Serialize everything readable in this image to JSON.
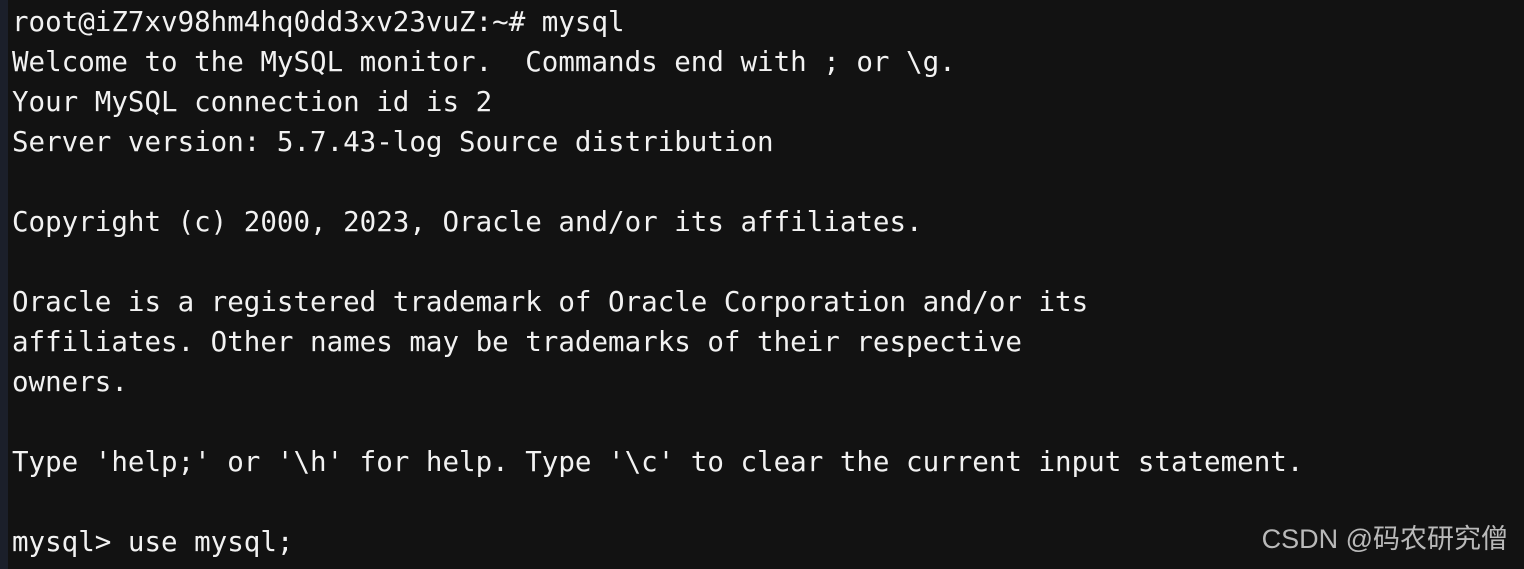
{
  "window": {
    "title": "root@iZ7xv98hm4hq0dd3xv23vuZ: ~",
    "background_color": "#121212",
    "text_color": "#f2f2f2",
    "gutter_color": "#1b1f2a"
  },
  "terminal": {
    "prompt_host": "root@iZ7xv98hm4hq0dd3xv23vuZ",
    "prompt_path": "~",
    "prompt_symbol": "#",
    "mysql_prompt": "mysql>",
    "lines": [
      {
        "id": 0,
        "kind": "prompt",
        "text": "root@iZ7xv98hm4hq0dd3xv23vuZ:~# mysql"
      },
      {
        "id": 1,
        "kind": "output",
        "text": "Welcome to the MySQL monitor.  Commands end with ; or \\g."
      },
      {
        "id": 2,
        "kind": "output",
        "text": "Your MySQL connection id is 2"
      },
      {
        "id": 3,
        "kind": "output",
        "text": "Server version: 5.7.43-log Source distribution"
      },
      {
        "id": 4,
        "kind": "blank",
        "text": " "
      },
      {
        "id": 5,
        "kind": "output",
        "text": "Copyright (c) 2000, 2023, Oracle and/or its affiliates."
      },
      {
        "id": 6,
        "kind": "blank",
        "text": " "
      },
      {
        "id": 7,
        "kind": "output",
        "text": "Oracle is a registered trademark of Oracle Corporation and/or its"
      },
      {
        "id": 8,
        "kind": "output",
        "text": "affiliates. Other names may be trademarks of their respective"
      },
      {
        "id": 9,
        "kind": "output",
        "text": "owners."
      },
      {
        "id": 10,
        "kind": "blank",
        "text": " "
      },
      {
        "id": 11,
        "kind": "output",
        "text": "Type 'help;' or '\\h' for help. Type '\\c' to clear the current input statement."
      },
      {
        "id": 12,
        "kind": "blank",
        "text": " "
      },
      {
        "id": 13,
        "kind": "command",
        "text": "mysql> use mysql;"
      },
      {
        "id": 14,
        "kind": "clipped",
        "text": "+--------+---------+"
      }
    ]
  },
  "watermark": {
    "text": "CSDN @码农研究僧"
  }
}
